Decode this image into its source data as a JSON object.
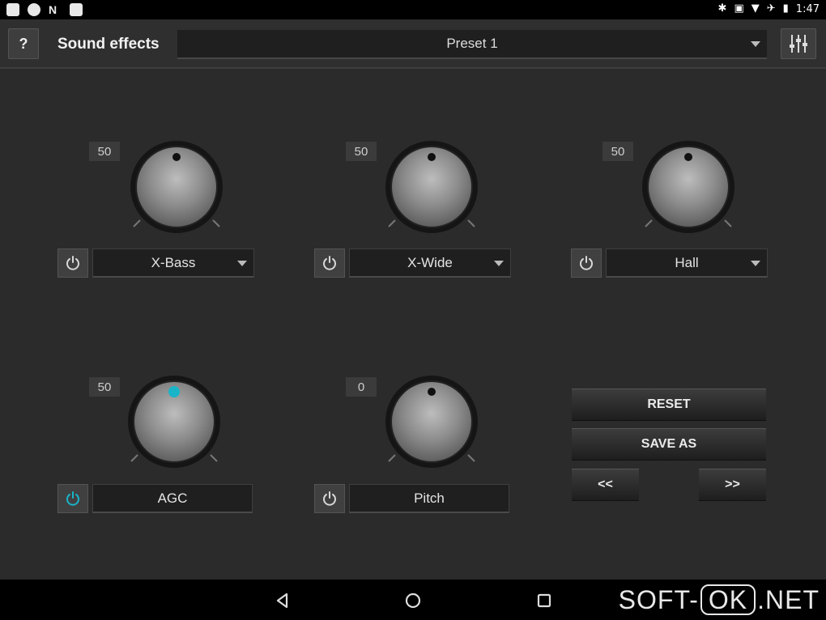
{
  "status_bar": {
    "time": "1:47"
  },
  "header": {
    "help_label": "?",
    "title": "Sound effects",
    "preset_value": "Preset 1"
  },
  "effects": [
    {
      "value": "50",
      "label": "X-Bass",
      "has_dropdown": true,
      "enabled": false
    },
    {
      "value": "50",
      "label": "X-Wide",
      "has_dropdown": true,
      "enabled": false
    },
    {
      "value": "50",
      "label": "Hall",
      "has_dropdown": true,
      "enabled": false
    },
    {
      "value": "50",
      "label": "AGC",
      "has_dropdown": false,
      "enabled": true
    },
    {
      "value": "0",
      "label": "Pitch",
      "has_dropdown": false,
      "enabled": false
    }
  ],
  "actions": {
    "reset": "RESET",
    "save_as": "SAVE AS",
    "prev": "<<",
    "next": ">>"
  },
  "watermark": {
    "left": "SOFT-",
    "box": "OK",
    "right": ".NET"
  },
  "colors": {
    "accent": "#19b4c8",
    "background": "#2b2b2c"
  }
}
